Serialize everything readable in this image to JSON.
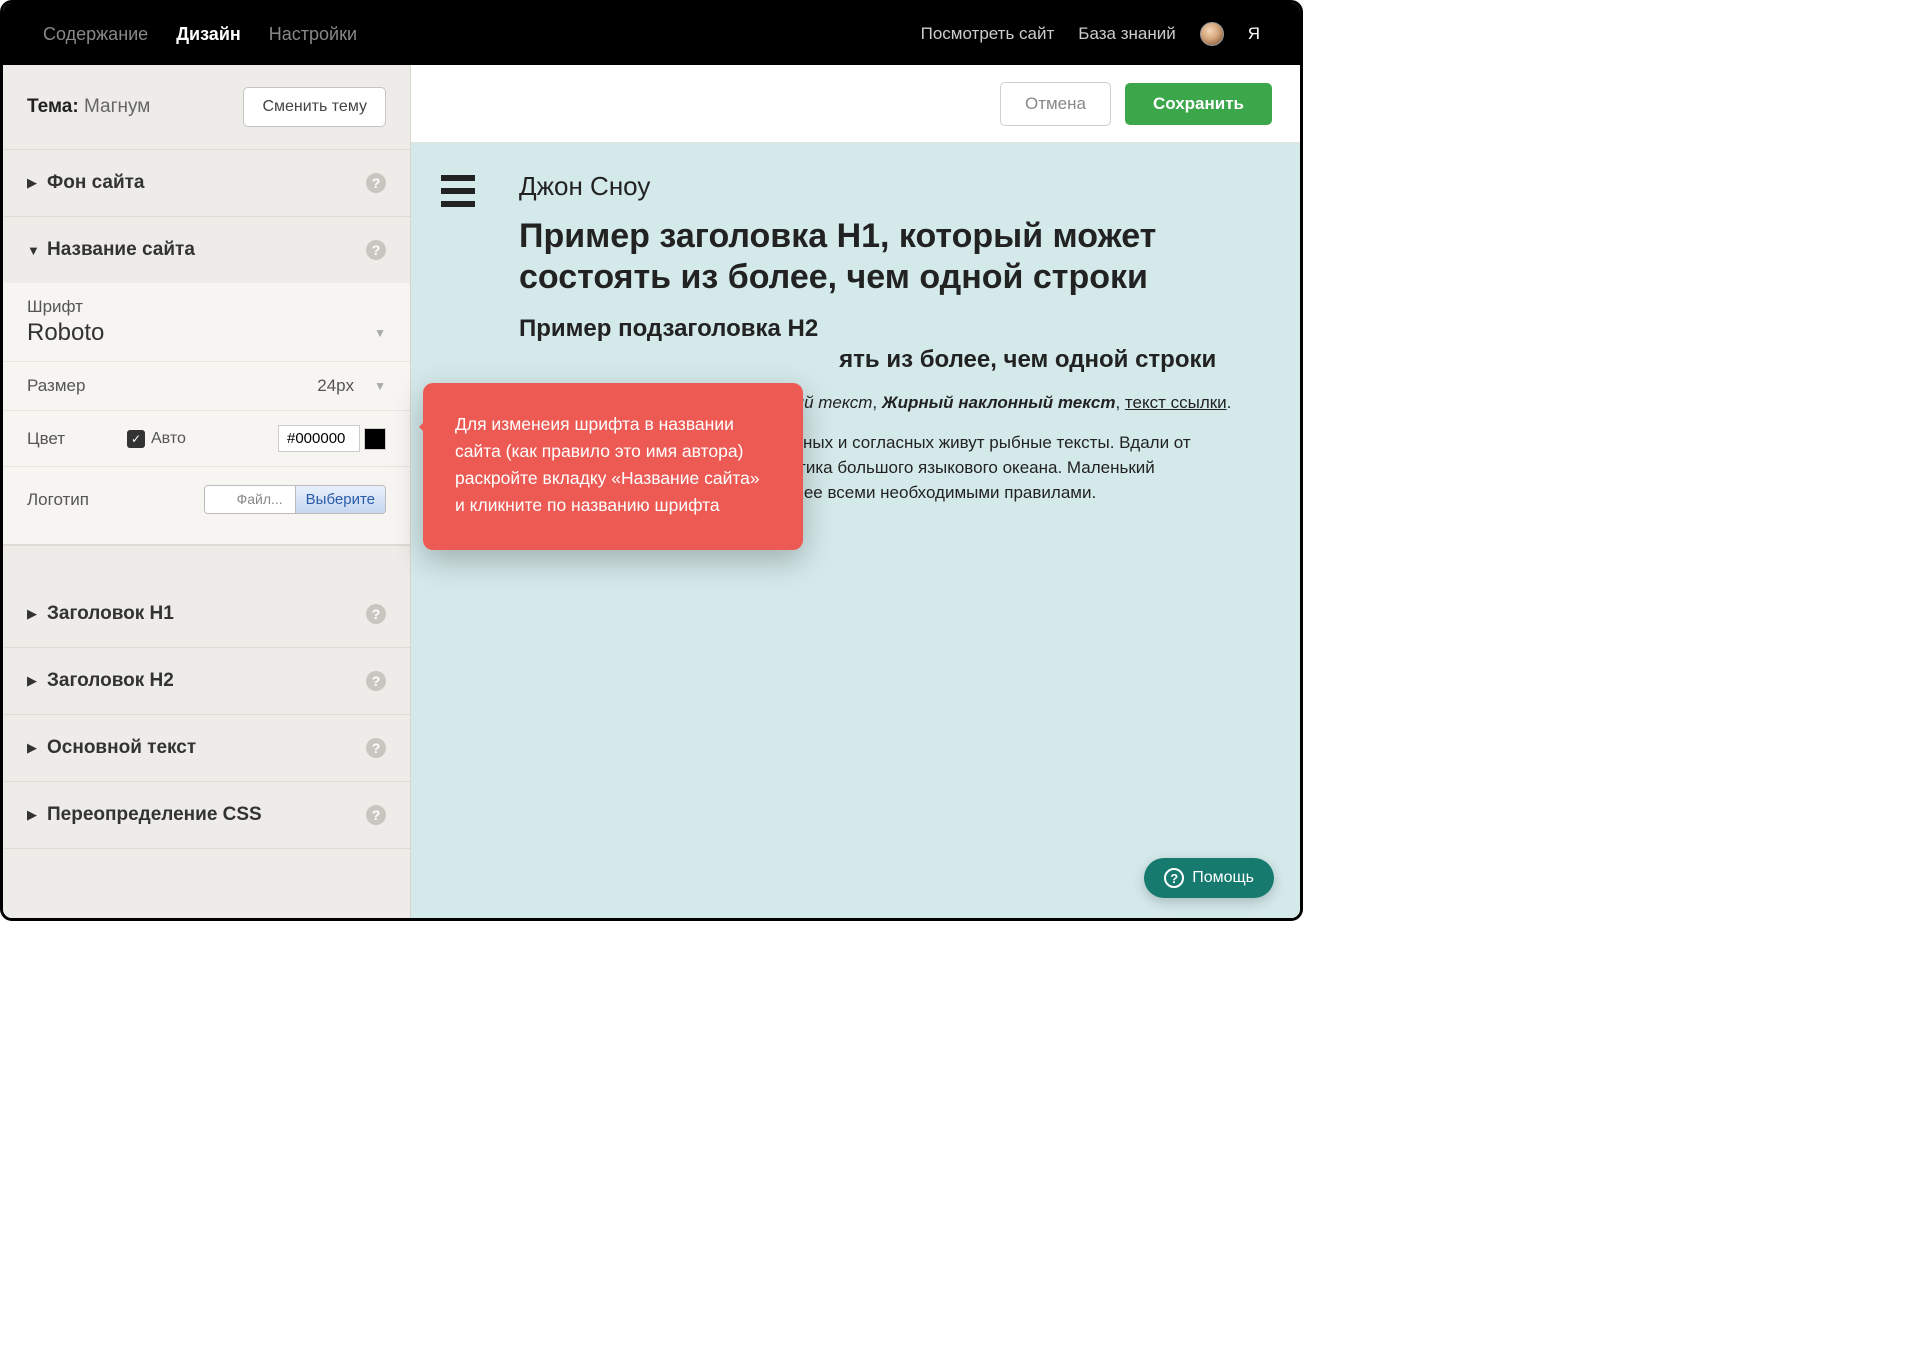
{
  "topbar": {
    "nav": [
      "Содержание",
      "Дизайн",
      "Настройки"
    ],
    "active_index": 1,
    "right": [
      "Посмотреть сайт",
      "База знаний"
    ],
    "user_letter": "Я"
  },
  "sidebar": {
    "theme_label": "Тема:",
    "theme_name": "Магнум",
    "change_theme": "Сменить тему",
    "sections": {
      "bg": "Фон сайта",
      "site_name": "Название сайта",
      "h1": "Заголовок H1",
      "h2": "Заголовок H2",
      "body": "Основной текст",
      "css": "Переопределение CSS"
    },
    "font": {
      "label": "Шрифт",
      "value": "Roboto"
    },
    "size": {
      "label": "Размер",
      "value": "24px"
    },
    "color": {
      "label": "Цвет",
      "auto_label": "Авто",
      "auto_checked": true,
      "value": "#000000"
    },
    "logo": {
      "label": "Логотип",
      "placeholder": "Файл...",
      "button": "Выберите"
    }
  },
  "actions": {
    "cancel": "Отмена",
    "save": "Сохранить"
  },
  "preview": {
    "site_name": "Джон Сноу",
    "h1": "Пример заголовка H1, который может состоять из более, чем одной строки",
    "h2_partial": "Пример подзаголовка H2",
    "h2_cont": "ять из более, чем одной строки",
    "styles_italic": "клонный текст",
    "styles_bolditalic": "Жирный наклонный текст",
    "styles_link": "текст ссылки",
    "para_l1": "не гласных и согласных живут рыбные тексты. Вдали от",
    "para_l2": "Семантика большого языкового океана. Маленький",
    "para_l3": "чивает ее всеми необходимыми правилами."
  },
  "tooltip": "Для изменеия шрифта в названии сайта (как правило это имя автора) раскройте вкладку «Название сайта» и кликните по названию шрифта",
  "help_fab": "Помощь"
}
